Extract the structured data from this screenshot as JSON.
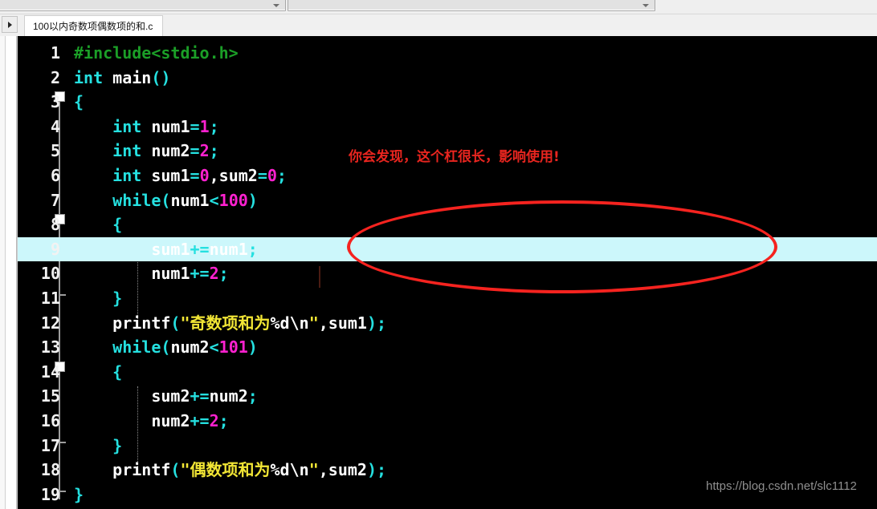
{
  "window": {
    "title": "100以内奇数项偶数项的和.c"
  },
  "toolbar": {
    "combo_left_value": "",
    "combo_right_value": "",
    "combo_arrow_icon": "chevron-down-icon"
  },
  "tabbar": {
    "scroll_button_icon": "triangle-right-icon",
    "tabs": [
      {
        "label": "100以内奇数项偶数项的和.c",
        "active": true
      }
    ]
  },
  "editor": {
    "language": "c",
    "background_color": "#000000",
    "highlight_color": "#ccf7fb",
    "highlighted_line": 9,
    "caret_line": 9,
    "caret_column": 24,
    "line_numbers": [
      1,
      2,
      3,
      4,
      5,
      6,
      7,
      8,
      9,
      10,
      11,
      12,
      13,
      14,
      15,
      16,
      17,
      18,
      19
    ],
    "fold_markers": [
      3,
      8,
      14
    ],
    "fold_ends": [
      11,
      17,
      19
    ],
    "lines": [
      {
        "n": "1",
        "text": "#include<stdio.h>"
      },
      {
        "n": "2",
        "text": "int main()"
      },
      {
        "n": "3",
        "text": "{"
      },
      {
        "n": "4",
        "text": "    int num1=1;"
      },
      {
        "n": "5",
        "text": "    int num2=2;"
      },
      {
        "n": "6",
        "text": "    int sum1=0,sum2=0;"
      },
      {
        "n": "7",
        "text": "    while(num1<100)"
      },
      {
        "n": "8",
        "text": "    {"
      },
      {
        "n": "9",
        "text": "        sum1+=num1;"
      },
      {
        "n": "10",
        "text": "        num1+=2;"
      },
      {
        "n": "11",
        "text": "    }"
      },
      {
        "n": "12",
        "text": "    printf(\"奇数项和为%d\\n\",sum1);"
      },
      {
        "n": "13",
        "text": "    while(num2<101)"
      },
      {
        "n": "14",
        "text": "    {"
      },
      {
        "n": "15",
        "text": "        sum2+=num2;"
      },
      {
        "n": "16",
        "text": "        num2+=2;"
      },
      {
        "n": "17",
        "text": "    }"
      },
      {
        "n": "18",
        "text": "    printf(\"偶数项和为%d\\n\",sum2);"
      },
      {
        "n": "19",
        "text": "}"
      }
    ]
  },
  "annotations": {
    "note_text": "你会发现，这个杠很长，影响使用!",
    "note_color": "#e8251f",
    "ellipse_color": "#f5231f"
  },
  "watermark": {
    "text": "https://blog.csdn.net/slc1112",
    "color": "#8f8f8f"
  },
  "colors": {
    "preprocessor": "#1b9e27",
    "keyword": "#25e0e0",
    "identifier": "#ffffff",
    "number": "#ff21d0",
    "string": "#f2e635",
    "operator": "#25e0e0",
    "line_number": "#f2f2f2"
  }
}
